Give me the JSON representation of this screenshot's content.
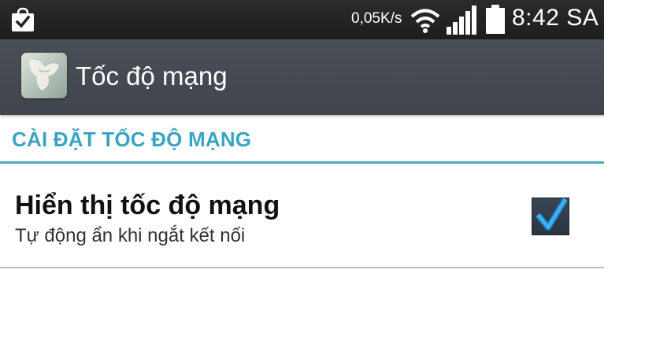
{
  "status_bar": {
    "network_speed": "0,05K/s",
    "time": "8:42 SA",
    "icons": [
      "shopping-bag-check-icon",
      "wifi-icon",
      "signal-icon",
      "battery-icon"
    ]
  },
  "action_bar": {
    "title": "Tốc độ mạng",
    "app_icon": "app-icon"
  },
  "preferences": {
    "category_label": "CÀI ĐẶT TỐC ĐỘ MẠNG",
    "items": [
      {
        "title": "Hiển thị tốc độ mạng",
        "summary": "Tự động ẩn khi ngắt kết nối",
        "checked": true
      }
    ]
  },
  "colors": {
    "accent": "#3aa4c2",
    "status_bar": "#222222",
    "action_bar": "#454a51",
    "checkbox_check": "#3bb0f0"
  }
}
